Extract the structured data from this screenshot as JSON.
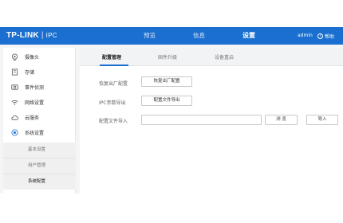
{
  "header": {
    "logo_brand": "TP-LINK",
    "logo_separator": "|",
    "logo_product": "IPC",
    "nav": [
      "预览",
      "信息",
      "设置"
    ],
    "active_nav": "设置",
    "user": "admin",
    "help_label": "帮助",
    "accent_color": "#1a6fd0"
  },
  "sidebar": {
    "items": [
      {
        "label": "摄像头",
        "icon": "camera-icon"
      },
      {
        "label": "存储",
        "icon": "storage-icon"
      },
      {
        "label": "事件侦测",
        "icon": "event-detection-icon"
      },
      {
        "label": "网络设置",
        "icon": "wifi-icon"
      },
      {
        "label": "云服务",
        "icon": "cloud-icon"
      },
      {
        "label": "系统设置",
        "icon": "system-settings-icon"
      }
    ],
    "sub_items": [
      "基本设置",
      "用户管理",
      "系统配置"
    ],
    "active_sub": "系统配置"
  },
  "main": {
    "tabs": [
      "配置管理",
      "固件升级",
      "设备重启"
    ],
    "active_tab": "配置管理",
    "rows": [
      {
        "label": "恢复出厂配置",
        "button": "恢复出厂配置"
      },
      {
        "label": "IPC参数导出",
        "button": "配置文件导出"
      },
      {
        "label": "配置文件导入",
        "input_value": "",
        "browse_button": "浏 览",
        "import_button": "导入"
      }
    ]
  }
}
